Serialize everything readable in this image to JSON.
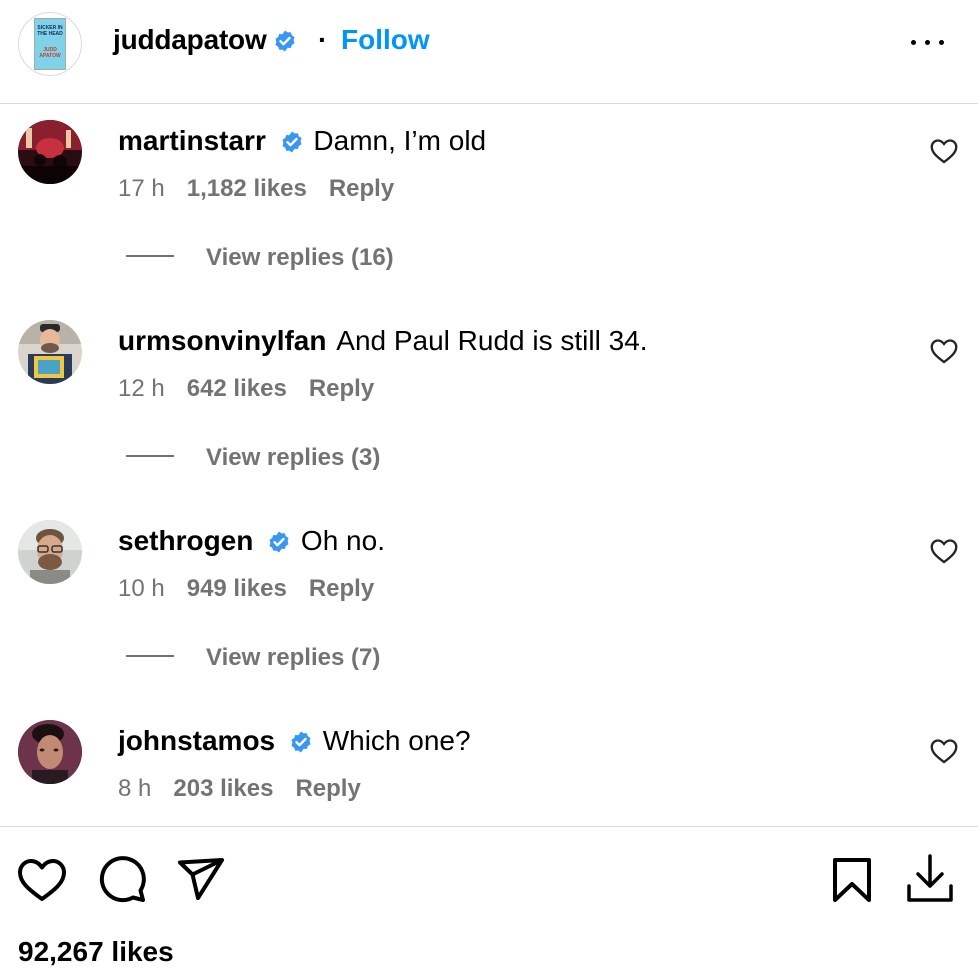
{
  "header": {
    "username": "juddapatow",
    "separator": "·",
    "follow_label": "Follow",
    "avatar_book_title": "SICKER IN THE HEAD",
    "avatar_book_author": "JUDD APATOW"
  },
  "comments": [
    {
      "username": "martinstarr",
      "verified": true,
      "text": "Damn, I’m old",
      "time": "17 h",
      "likes": "1,182 likes",
      "reply": "Reply",
      "view_replies": "View replies (16)"
    },
    {
      "username": "urmsonvinylfan",
      "verified": false,
      "text": "And Paul Rudd is still 34.",
      "time": "12 h",
      "likes": "642 likes",
      "reply": "Reply",
      "view_replies": "View replies (3)"
    },
    {
      "username": "sethrogen",
      "verified": true,
      "text": "Oh no.",
      "time": "10 h",
      "likes": "949 likes",
      "reply": "Reply",
      "view_replies": "View replies (7)"
    },
    {
      "username": "johnstamos",
      "verified": true,
      "text": "Which one?",
      "time": "8 h",
      "likes": "203 likes",
      "reply": "Reply"
    }
  ],
  "footer": {
    "likes_total": "92,267 likes"
  },
  "icons": {
    "verified": "verified-badge-icon",
    "more": "more-options-icon",
    "comment_like": "heart-outline-icon",
    "actions": [
      "like-icon",
      "comment-icon",
      "share-icon",
      "save-icon",
      "download-icon"
    ]
  },
  "colors": {
    "accent": "#0095f6",
    "verified": "#3897f0",
    "muted": "#737373",
    "divider": "#dbdbdb"
  }
}
